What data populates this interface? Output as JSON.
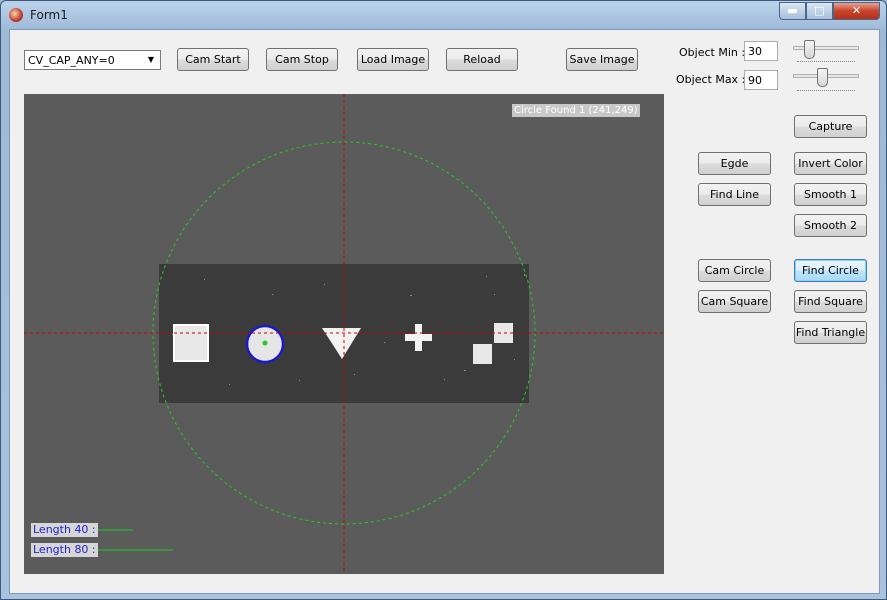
{
  "window": {
    "title": "Form1"
  },
  "titlebar": {
    "minimize_glyph": "▬",
    "maximize_glyph": "□",
    "close_glyph": "✕"
  },
  "toolbar": {
    "camera_select": {
      "value": "CV_CAP_ANY=0",
      "arrow": "▼"
    },
    "cam_start": "Cam Start",
    "cam_stop": "Cam Stop",
    "load_image": "Load Image",
    "reload": "Reload",
    "save_image": "Save Image"
  },
  "settings": {
    "object_min_label": "Object Min :",
    "object_min_value": "30",
    "object_max_label": "Object Max :",
    "object_max_value": "90"
  },
  "side_buttons": {
    "capture": "Capture",
    "edge": "Egde",
    "invert_color": "Invert Color",
    "find_line": "Find Line",
    "smooth1": "Smooth 1",
    "smooth2": "Smooth 2",
    "cam_circle": "Cam Circle",
    "find_circle": "Find Circle",
    "cam_square": "Cam Square",
    "find_square": "Find Square",
    "find_triangle": "Find Triangle"
  },
  "view": {
    "status": "Circle Found 1 (241,249)",
    "length40": "Length 40 :",
    "length80": "Length 80 :"
  },
  "colors": {
    "crosshair": "#cc0000",
    "guide_circle": "#22cc22",
    "detected_circle": "#1a1acc",
    "center_dot": "#22cc22",
    "active_button": "#bee6fd"
  },
  "icons": {
    "app": "app-icon",
    "dropdown": "chevron-down-icon"
  }
}
